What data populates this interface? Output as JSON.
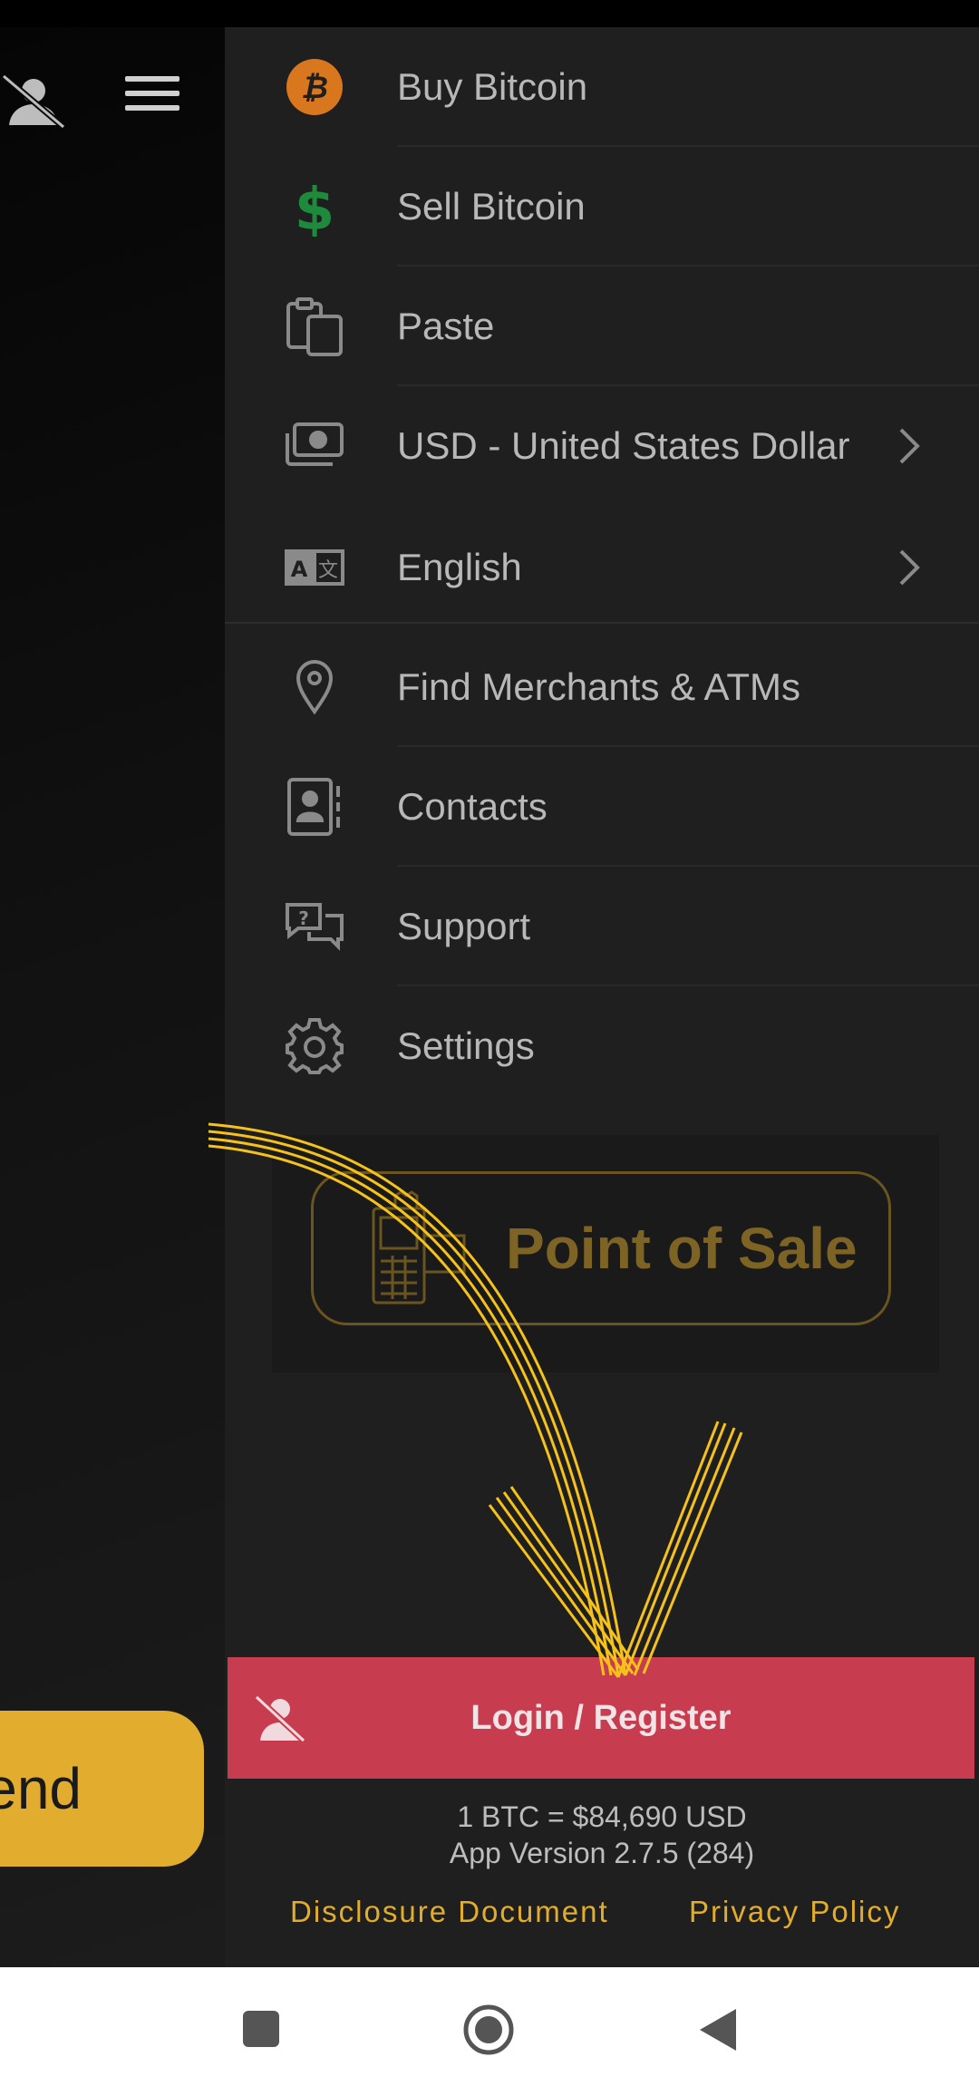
{
  "left": {
    "send_label": "end"
  },
  "drawer": {
    "items": [
      {
        "label": "Buy Bitcoin",
        "icon": "bitcoin-icon",
        "has_chevron": false
      },
      {
        "label": "Sell Bitcoin",
        "icon": "dollar-icon",
        "has_chevron": false
      },
      {
        "label": "Paste",
        "icon": "clipboard-icon",
        "has_chevron": false
      },
      {
        "label": "USD - United States Dollar",
        "icon": "currency-icon",
        "has_chevron": true
      },
      {
        "label": "English",
        "icon": "language-icon",
        "has_chevron": true
      },
      {
        "label": "Find Merchants & ATMs",
        "icon": "location-pin-icon",
        "has_chevron": false
      },
      {
        "label": "Contacts",
        "icon": "contacts-icon",
        "has_chevron": false
      },
      {
        "label": "Support",
        "icon": "support-chat-icon",
        "has_chevron": false
      },
      {
        "label": "Settings",
        "icon": "gear-icon",
        "has_chevron": false
      }
    ],
    "point_of_sale_label": "Point of Sale",
    "login_label": "Login / Register",
    "price_line": "1 BTC = $84,690 USD",
    "version_line": "App Version 2.7.5 (284)",
    "disclosure_link": "Disclosure Document",
    "privacy_link": "Privacy Policy"
  },
  "colors": {
    "accent": "#e3ad2c",
    "login": "#c83c50",
    "bitcoin": "#d9771f",
    "dollar": "#1e8a3c",
    "arrow": "#f5c21b"
  }
}
